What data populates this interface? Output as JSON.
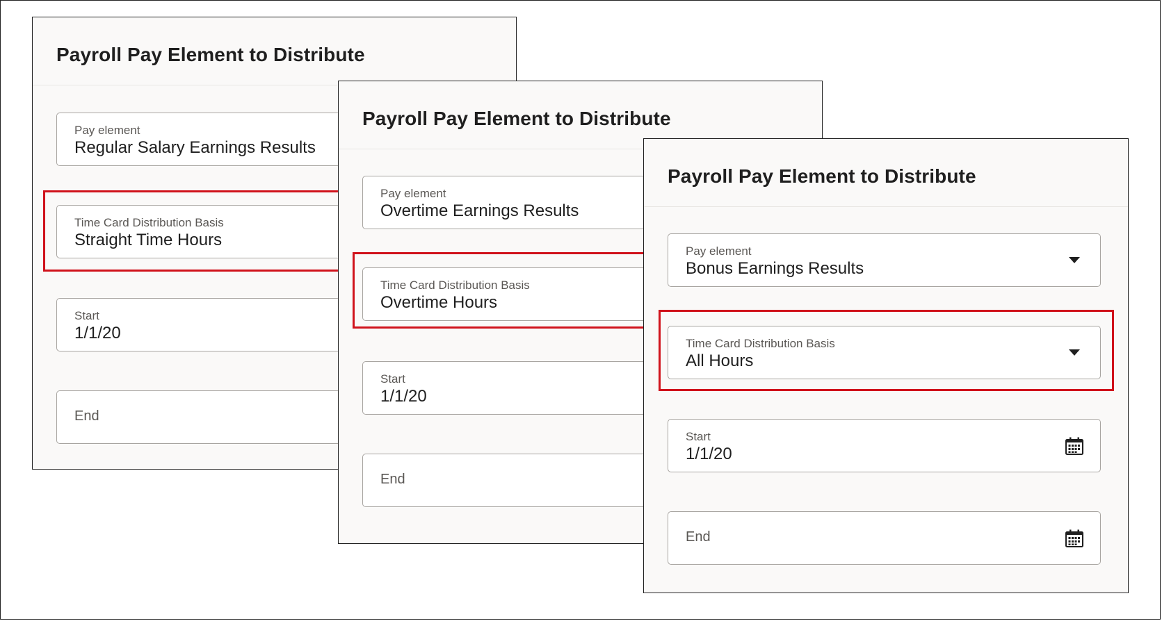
{
  "panels": [
    {
      "title": "Payroll Pay Element to Distribute",
      "pay_element": {
        "label": "Pay element",
        "value": "Regular Salary Earnings Results"
      },
      "distribution_basis": {
        "label": "Time Card Distribution Basis",
        "value": "Straight Time Hours"
      },
      "start": {
        "label": "Start",
        "value": "1/1/20"
      },
      "end": {
        "label": "End"
      }
    },
    {
      "title": "Payroll Pay Element to Distribute",
      "pay_element": {
        "label": "Pay element",
        "value": "Overtime Earnings Results"
      },
      "distribution_basis": {
        "label": "Time Card Distribution Basis",
        "value": "Overtime Hours"
      },
      "start": {
        "label": "Start",
        "value": "1/1/20"
      },
      "end": {
        "label": "End"
      }
    },
    {
      "title": "Payroll Pay Element to Distribute",
      "pay_element": {
        "label": "Pay element",
        "value": "Bonus Earnings Results"
      },
      "distribution_basis": {
        "label": "Time Card Distribution Basis",
        "value": "All Hours"
      },
      "start": {
        "label": "Start",
        "value": "1/1/20"
      },
      "end": {
        "label": "End"
      }
    }
  ],
  "icons": {
    "dropdown": "chevron-down-icon",
    "date": "calendar-icon"
  },
  "colors": {
    "highlight": "#d0121b",
    "panel_background": "#faf9f8",
    "field_border": "#a8a5a1"
  }
}
